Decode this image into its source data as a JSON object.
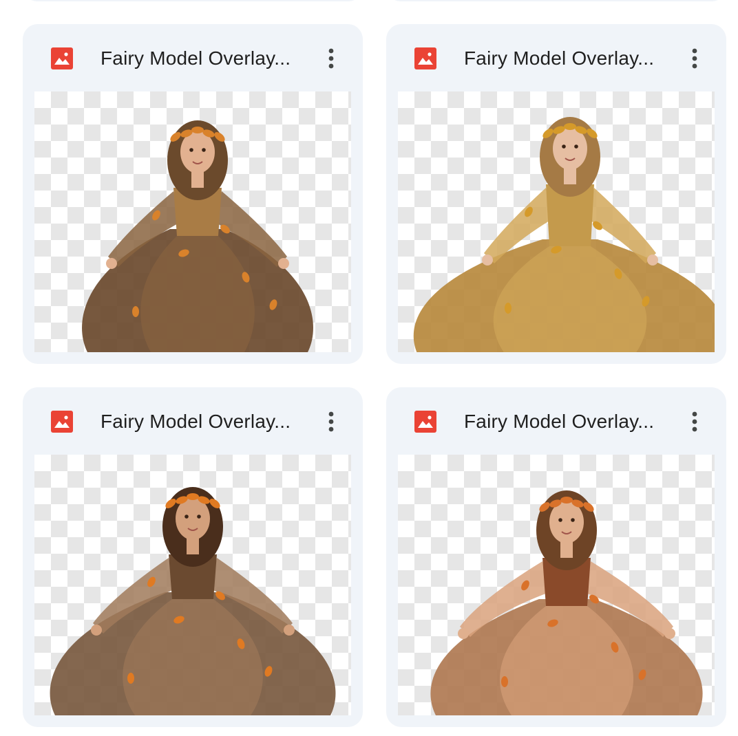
{
  "files": [
    {
      "title": "Fairy Model Overlay...",
      "icon": "image-file-icon",
      "menu_icon": "more-vert-icon",
      "thumbnail": "fairy-girl-brown-dress",
      "colors": {
        "dress": "#6b4a2e",
        "dress_light": "#8a6440",
        "bodice": "#a97c45",
        "hair": "#6b4a2c",
        "skin": "#e2b190",
        "leaf": "#d9822b"
      }
    },
    {
      "title": "Fairy Model Overlay...",
      "icon": "image-file-icon",
      "menu_icon": "more-vert-icon",
      "thumbnail": "fairy-girl-golden-ruffle-gown",
      "colors": {
        "dress": "#b88a3e",
        "dress_light": "#d2a85a",
        "bodice": "#c49a4c",
        "hair": "#a57a45",
        "skin": "#e6bea2",
        "leaf": "#d59a2a"
      }
    },
    {
      "title": "Fairy Model Overlay...",
      "icon": "image-file-icon",
      "menu_icon": "more-vert-icon",
      "thumbnail": "fairy-girl-twirling-brown-dress",
      "colors": {
        "dress": "#7a5a40",
        "dress_light": "#a07a5a",
        "bodice": "#6b4a30",
        "hair": "#4a2e1c",
        "skin": "#d3a07c",
        "leaf": "#e07a22"
      }
    },
    {
      "title": "Fairy Model Overlay...",
      "icon": "image-file-icon",
      "menu_icon": "more-vert-icon",
      "thumbnail": "fairy-girl-copper-sheer-dress",
      "colors": {
        "dress": "#b07a52",
        "dress_light": "#d9a27c",
        "bodice": "#8a4a2a",
        "hair": "#6e4426",
        "skin": "#e0b08e",
        "leaf": "#d9722a"
      }
    }
  ],
  "theme": {
    "card_bg": "#f0f4f9",
    "title_color": "#1f1f1f",
    "icon_red": "#ea4335"
  }
}
